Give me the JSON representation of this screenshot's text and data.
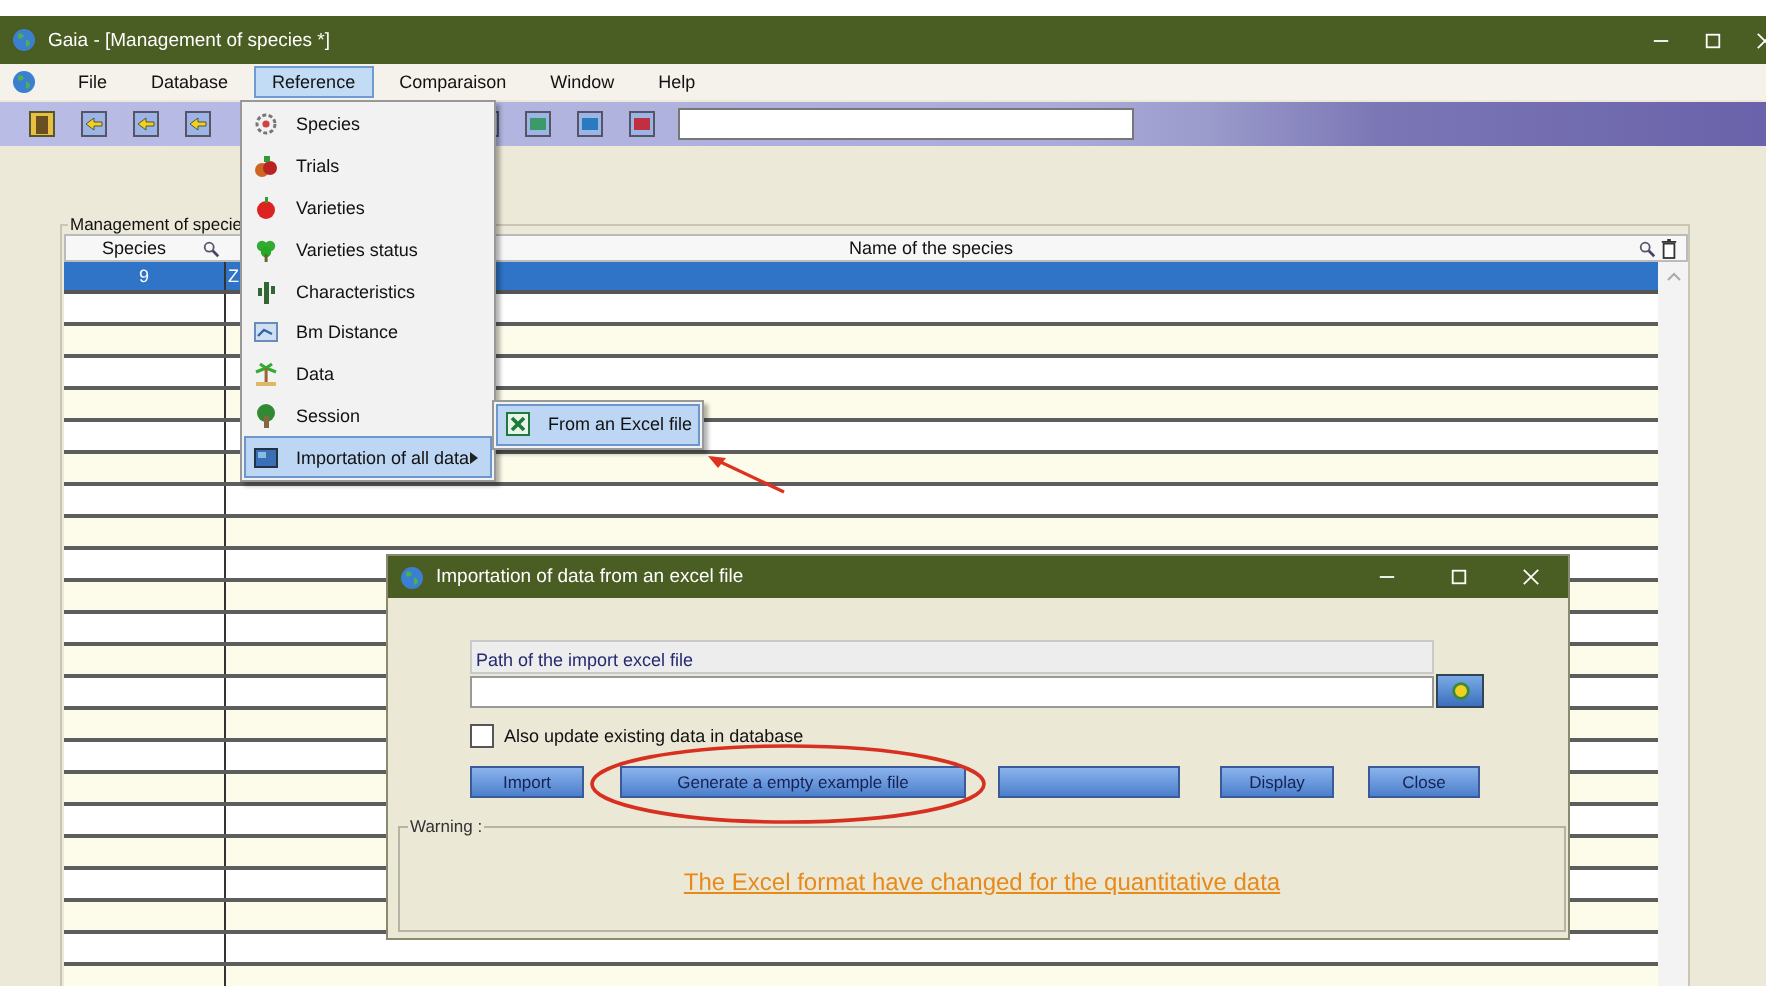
{
  "window": {
    "title": "Gaia - [Management of species *]"
  },
  "menu_bar": [
    {
      "label": "File",
      "selected": false
    },
    {
      "label": "Database",
      "selected": false
    },
    {
      "label": "Reference",
      "selected": true
    },
    {
      "label": "Comparaison",
      "selected": false
    },
    {
      "label": "Window",
      "selected": false
    },
    {
      "label": "Help",
      "selected": false
    }
  ],
  "panel": {
    "title": "Management of specie",
    "columns": [
      "Species",
      "Name of the species"
    ],
    "rows": [
      {
        "species": "9",
        "name": "Z",
        "selected": true
      }
    ]
  },
  "dropdown": {
    "items": [
      {
        "label": "Species",
        "selected": false,
        "has_submenu": false
      },
      {
        "label": "Trials",
        "selected": false,
        "has_submenu": false
      },
      {
        "label": "Varieties",
        "selected": false,
        "has_submenu": false
      },
      {
        "label": "Varieties status",
        "selected": false,
        "has_submenu": false
      },
      {
        "label": "Characteristics",
        "selected": false,
        "has_submenu": false
      },
      {
        "label": "Bm Distance",
        "selected": false,
        "has_submenu": false
      },
      {
        "label": "Data",
        "selected": false,
        "has_submenu": false
      },
      {
        "label": "Session",
        "selected": false,
        "has_submenu": false
      },
      {
        "label": "Importation of all data",
        "selected": true,
        "has_submenu": true
      }
    ]
  },
  "submenu": {
    "items": [
      {
        "label": "From an Excel file",
        "selected": true,
        "pointed_by_arrow": true
      }
    ]
  },
  "dialog": {
    "title": "Importation of data from an excel file",
    "path_label": "Path of the import excel file",
    "also_update": {
      "label": "Also update existing data in database",
      "checked": false
    },
    "buttons": [
      {
        "kind": "text",
        "label": "Import"
      },
      {
        "kind": "text",
        "label": "Generate a empty example file",
        "circled": true
      },
      {
        "kind": "blank"
      },
      {
        "kind": "text",
        "label": "Display"
      },
      {
        "kind": "text",
        "label": "Close"
      }
    ],
    "warning": {
      "title": "Warning :",
      "message": "The Excel format have changed for the quantitative data"
    }
  }
}
